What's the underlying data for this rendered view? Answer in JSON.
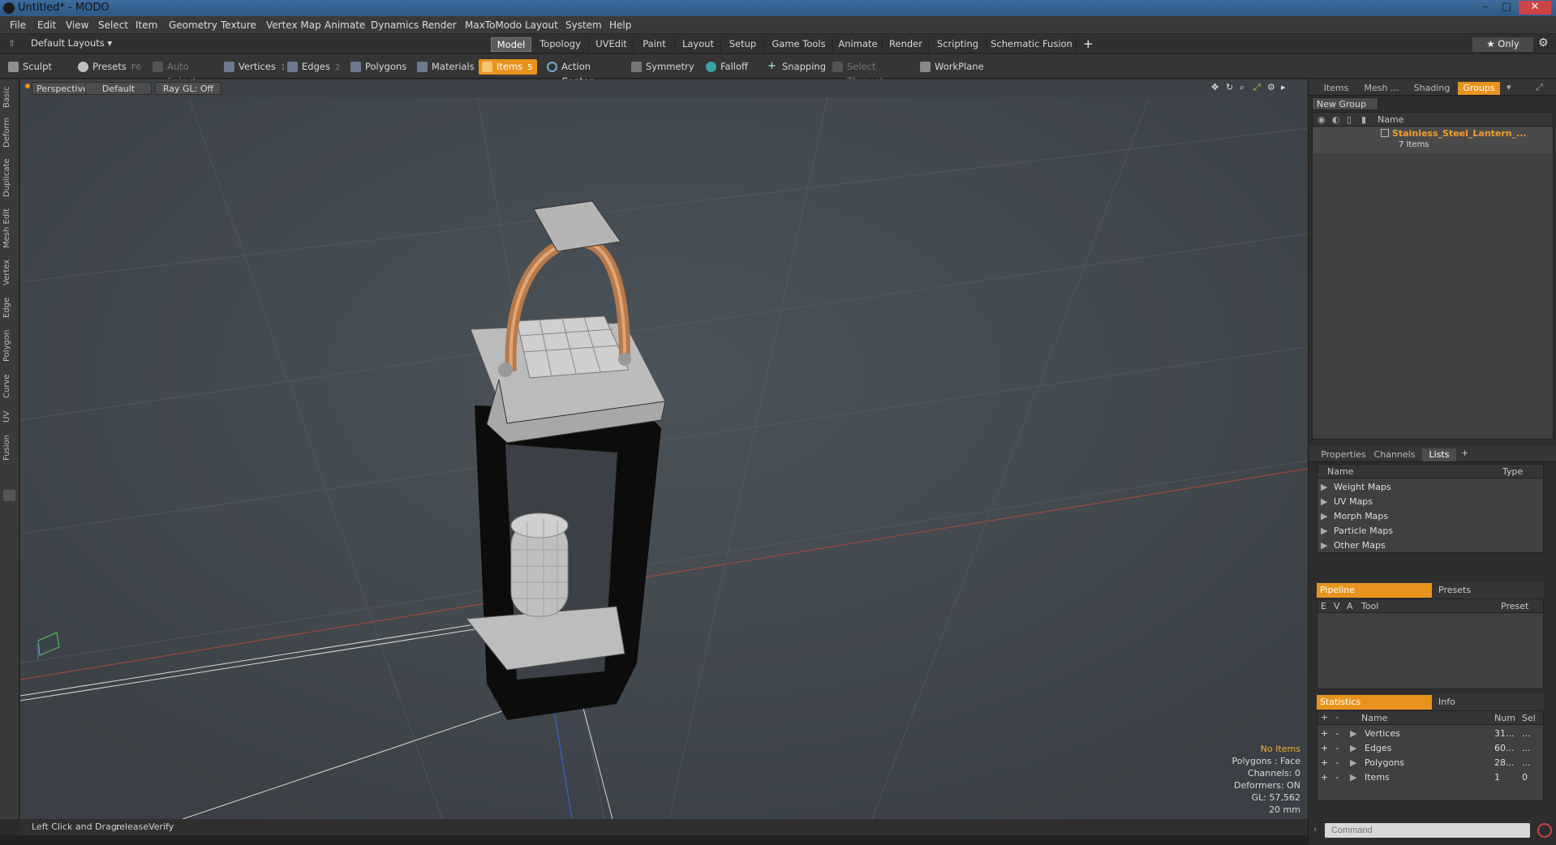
{
  "window": {
    "title": "Untitled* - MODO",
    "minimize": "–",
    "maximize": "□",
    "close": "✕"
  },
  "menu": [
    "File",
    "Edit",
    "View",
    "Select",
    "Item",
    "Geometry",
    "Texture",
    "Vertex Map",
    "Animate",
    "Dynamics",
    "Render",
    "MaxToModo",
    "Layout",
    "System",
    "Help"
  ],
  "layout": {
    "selector": "Default Layouts ▾",
    "tabs": [
      "Model",
      "Topology",
      "UVEdit",
      "Paint",
      "Layout",
      "Setup",
      "Game Tools",
      "Animate",
      "Render",
      "Scripting",
      "Schematic Fusion"
    ],
    "active_tab": "Model",
    "add": "+",
    "only": "★ Only",
    "gear": "⚙"
  },
  "toolbar": {
    "sculpt": "Sculpt",
    "presets": "Presets",
    "presets_key": "F6",
    "auto_select": "Auto Select",
    "vertices": "Vertices",
    "vertices_key": "1",
    "edges": "Edges",
    "edges_key": "2",
    "polygons": "Polygons",
    "materials": "Materials",
    "items": "Items",
    "items_key": "5",
    "action_center": "Action Center",
    "symmetry": "Symmetry",
    "falloff": "Falloff",
    "snapping": "Snapping",
    "select_through": "Select Through",
    "workplane": "WorkPlane"
  },
  "left_tabs": [
    "Basic",
    "Deform",
    "Duplicate",
    "Mesh Edit",
    "Vertex",
    "Edge",
    "Polygon",
    "Curve",
    "UV",
    "Fusion"
  ],
  "viewport": {
    "view": "Perspective",
    "shading": "Default",
    "raygl": "Ray GL: Off",
    "info": {
      "items": "No Items",
      "polygons": "Polygons : Face",
      "channels": "Channels: 0",
      "deformers": "Deformers: ON",
      "gl": "GL: 57,562",
      "scale": "20 mm"
    }
  },
  "status": {
    "hint": "Left Click and Drag:",
    "action": "releaseVerify"
  },
  "groups_panel": {
    "tabs": [
      "Items",
      "Mesh ...",
      "Shading",
      "Groups"
    ],
    "active_tab": "Groups",
    "new_group": "New Group",
    "col_name": "Name",
    "group_name": "Stainless_Steel_Lantern_...",
    "group_count": "7 Items"
  },
  "lists_panel": {
    "tabs": [
      "Properties",
      "Channels",
      "Lists"
    ],
    "active_tab": "Lists",
    "add": "+",
    "col_name": "Name",
    "col_type": "Type",
    "items": [
      "Weight Maps",
      "UV Maps",
      "Morph Maps",
      "Particle Maps",
      "Other Maps"
    ]
  },
  "pipeline_panel": {
    "tabs": [
      "Pipeline",
      "Presets"
    ],
    "cols": [
      "E",
      "V",
      "A",
      "Tool",
      "Preset"
    ]
  },
  "stats_panel": {
    "tabs": [
      "Statistics",
      "Info"
    ],
    "cols": [
      "Name",
      "Num",
      "Sel"
    ],
    "add": "+",
    "remove": "-",
    "rows": [
      {
        "name": "Vertices",
        "num": "31...",
        "sel": "..."
      },
      {
        "name": "Edges",
        "num": "60...",
        "sel": "..."
      },
      {
        "name": "Polygons",
        "num": "28...",
        "sel": "..."
      },
      {
        "name": "Items",
        "num": "1",
        "sel": "0"
      }
    ]
  },
  "command": {
    "placeholder": "Command"
  },
  "colors": {
    "accent": "#e8931d",
    "viewport_bg": "#434a50",
    "group_name": "#f0a030"
  }
}
